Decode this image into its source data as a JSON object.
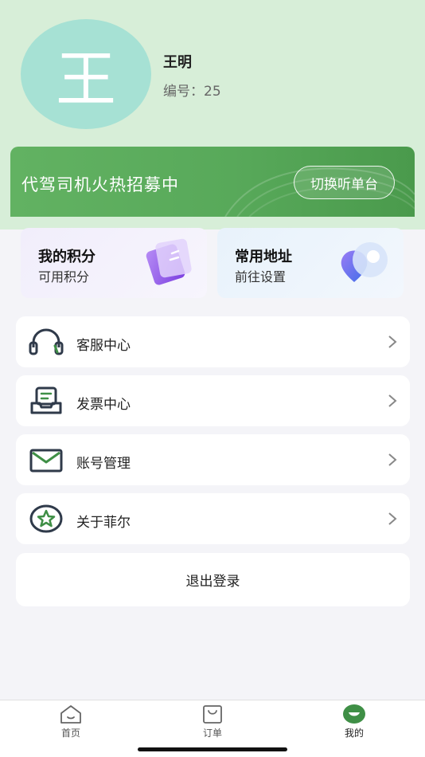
{
  "profile": {
    "avatar_char": "王",
    "name": "王明",
    "id_label": "编号：",
    "id_value": "25"
  },
  "banner": {
    "text": "代驾司机火热招募中",
    "button_label": "切换听单台"
  },
  "cards": {
    "points": {
      "title": "我的积分",
      "subtitle": "可用积分"
    },
    "address": {
      "title": "常用地址",
      "subtitle": "前往设置"
    }
  },
  "menu": [
    {
      "label": "客服中心",
      "icon": "headset-icon"
    },
    {
      "label": "发票中心",
      "icon": "invoice-icon"
    },
    {
      "label": "账号管理",
      "icon": "mail-icon"
    },
    {
      "label": "关于菲尔",
      "icon": "star-badge-icon"
    }
  ],
  "logout_label": "退出登录",
  "tabbar": {
    "items": [
      {
        "label": "首页",
        "icon": "home-icon"
      },
      {
        "label": "订单",
        "icon": "bag-icon"
      },
      {
        "label": "我的",
        "icon": "smile-icon",
        "active": true
      }
    ]
  },
  "colors": {
    "header_bg": "#d7eed8",
    "avatar_bg": "#a6e1d4",
    "banner_green": "#58a95a",
    "accent_green": "#3f8f46"
  }
}
